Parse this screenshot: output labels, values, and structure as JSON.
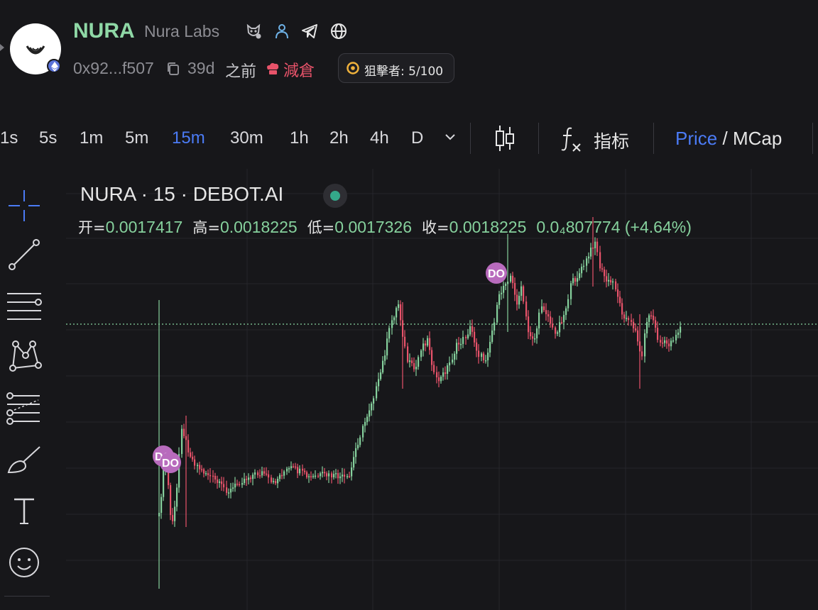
{
  "token": {
    "symbol": "NURA",
    "name": "Nura Labs",
    "address": "0x92...f507",
    "age": "39d",
    "age_suffix": "之前",
    "reduce_label": "減倉",
    "sniper_label": "狙擊者: 5/100",
    "social_icons": [
      "owl-icon",
      "person-icon",
      "telegram-icon",
      "globe-icon"
    ]
  },
  "toolbar": {
    "timeframes": [
      "1s",
      "5s",
      "1m",
      "5m",
      "15m",
      "30m",
      "1h",
      "2h",
      "4h",
      "D"
    ],
    "active_timeframe": "15m",
    "indicator_label": "指标",
    "price_label": "Price",
    "separator": "/",
    "mcap_label": "MCap"
  },
  "chart": {
    "title": "NURA · 15 · DEBOT.AI",
    "ohlc": {
      "open_label": "开=",
      "open": "0.0017417",
      "high_label": "高=",
      "high": "0.0018225",
      "low_label": "低=",
      "low": "0.0017326",
      "close_label": "收=",
      "close": "0.0018225",
      "change": "0.0₄807774",
      "change_pct": "(+4.64%)"
    },
    "markers": [
      "DO",
      "DO",
      "DO"
    ]
  },
  "colors": {
    "up": "#86d19d",
    "down": "#e8536a",
    "accent": "#4b7bf5",
    "brand": "#8fd8a6",
    "marker": "#b86bbd"
  }
}
